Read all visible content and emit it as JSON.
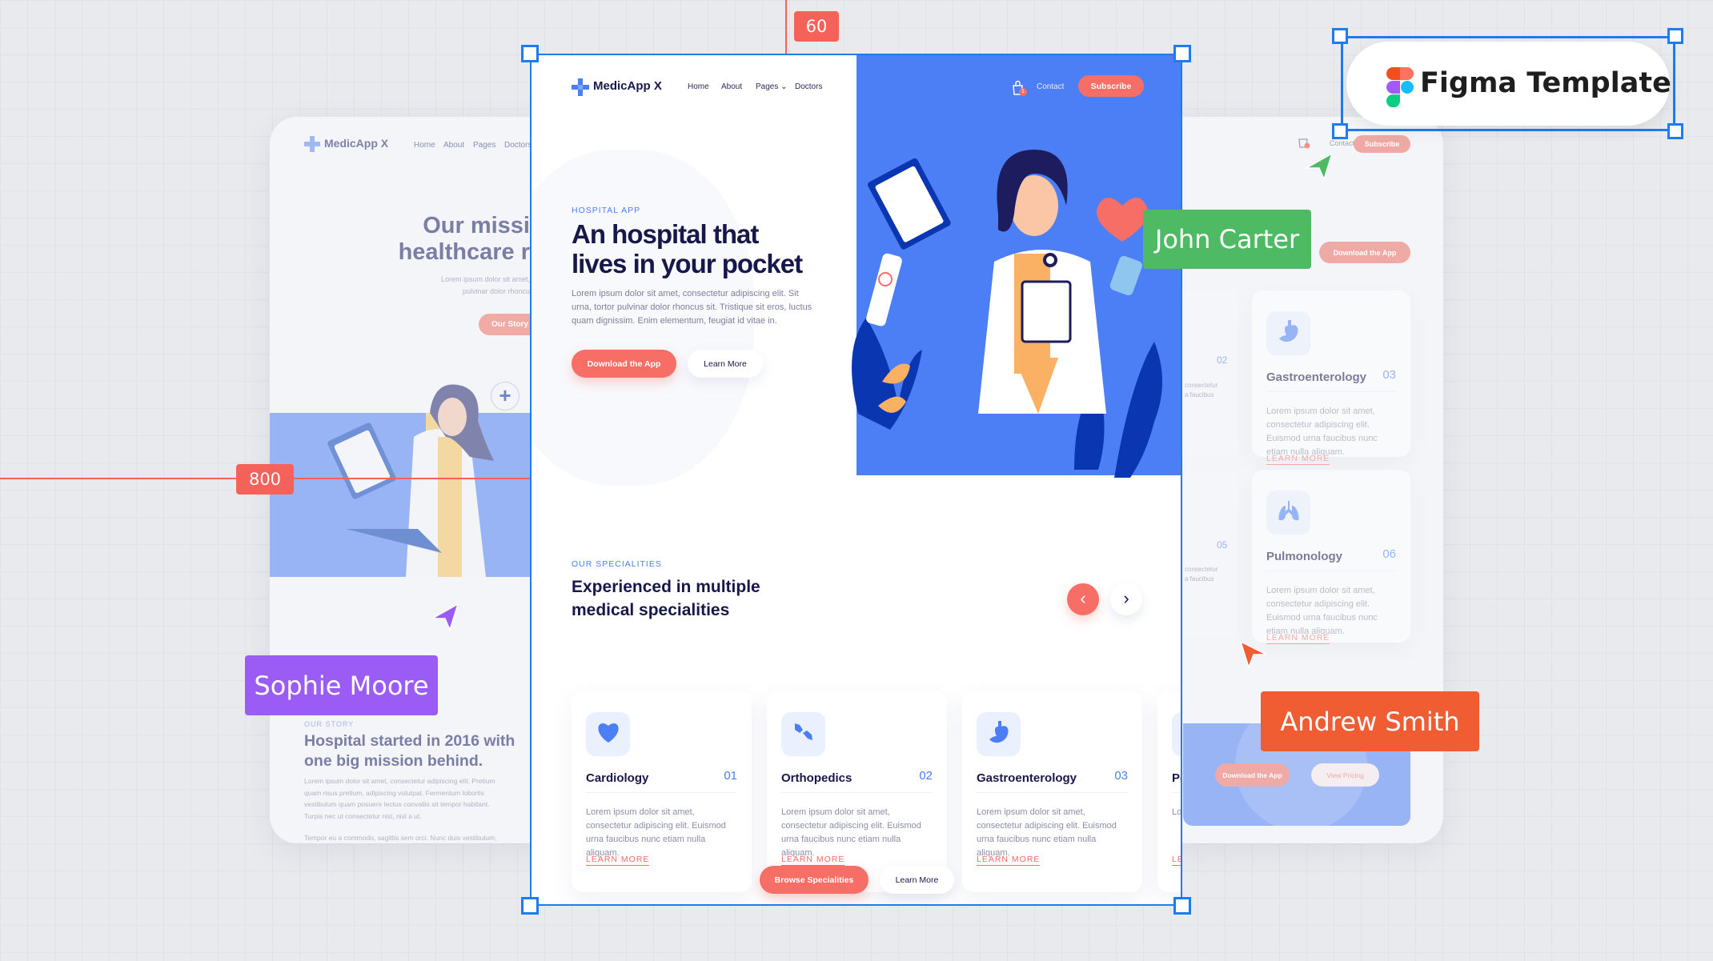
{
  "colors": {
    "accent_blue": "#4c7ff5",
    "coral": "#f66e65",
    "navy": "#17184a",
    "green": "#4fba64",
    "purple": "#9b5cf6",
    "orange": "#f05d33",
    "selection": "#1f7cf0"
  },
  "nav": {
    "brand": "MedicApp X",
    "links": [
      "Home",
      "About",
      "Pages",
      "Doctors"
    ],
    "contact": "Contact",
    "subscribe": "Subscribe",
    "cart_count": "1"
  },
  "hero": {
    "eyebrow": "HOSPITAL APP",
    "title_line1": "An hospital that",
    "title_line2": "lives in your pocket",
    "body": "Lorem ipsum dolor sit amet, consectetur adipiscing elit. Sit urna, tortor pulvinar dolor rhoncus sit. Tristique sit eros, luctus quam dignissim. Enim elementum, feugiat id vitae in.",
    "primary": "Download the App",
    "secondary": "Learn More"
  },
  "specialities": {
    "eyebrow": "OUR SPECIALITIES",
    "title_line1": "Experienced in multiple",
    "title_line2": "medical specialities",
    "cards": [
      {
        "icon": "heart-icon",
        "title": "Cardiology",
        "number": "01",
        "body": "Lorem ipsum dolor sit amet, consectetur adipiscing elit. Euismod urna faucibus nunc etiam nulla aliquam.",
        "link": "LEARN MORE"
      },
      {
        "icon": "bones-icon",
        "title": "Orthopedics",
        "number": "02",
        "body": "Lorem ipsum dolor sit amet, consectetur adipiscing elit. Euismod urna faucibus nunc etiam nulla aliquam.",
        "link": "LEARN MORE"
      },
      {
        "icon": "stomach-icon",
        "title": "Gastroenterology",
        "number": "03",
        "body": "Lorem ipsum dolor sit amet, consectetur adipiscing elit. Euismod urna faucibus nunc etiam nulla aliquam.",
        "link": "LEARN MORE"
      },
      {
        "icon": "lungs-icon",
        "title": "Pe",
        "number": "",
        "body": "Lo ad nu",
        "link": "LE"
      }
    ],
    "browse": "Browse Specialities",
    "learn": "Learn More"
  },
  "left_page": {
    "brand": "MedicApp X",
    "links": [
      "Home",
      "About",
      "Pages",
      "Doctors"
    ],
    "title_line1": "Our missi",
    "title_line2": "healthcare r",
    "body_line1": "Lorem ipsum dolor sit amet,",
    "body_line2": "pulvinar dolor rhoncu",
    "button": "Our Story",
    "story_eyebrow": "OUR STORY",
    "story_title_line1": "Hospital started in 2016 with",
    "story_title_line2": "one big mission behind.",
    "story_body": "Lorem ipsum dolor sit amet, consectetur adipiscing elit. Pretium quam risus pretium, adipiscing volutpat. Fermentum lobortis vestibulum quam posuere lectus convallis sit tempor habitant. Turpis nec ut consectetur nisi, nisl a ut.",
    "story_body2": "Tempor eu a commodo, sagittis sem orci. Nunc duis vestibulum,"
  },
  "right_page": {
    "contact": "Contact",
    "subscribe": "Subscribe",
    "download": "Download the App",
    "partial_text1": "consectetur",
    "partial_text2": "a faucibus",
    "partial_num1": "02",
    "partial_num2": "05",
    "cards": [
      {
        "title": "Gastroenterology",
        "number": "03",
        "body": "Lorem ipsum dolor sit amet, consectetur adipiscing elit. Euismod urna faucibus nunc etiam nulla aliquam.",
        "link": "LEARN MORE"
      },
      {
        "title": "Pulmonology",
        "number": "06",
        "body": "Lorem ipsum dolor sit amet, consectetur adipiscing elit. Euismod urna faucibus nunc etiam nulla aliquam.",
        "link": "LEARN MORE"
      }
    ],
    "cta_download": "Download the App",
    "cta_pricing": "View Pricing"
  },
  "overlay": {
    "ruler_x": "60",
    "ruler_y": "800",
    "figma_label": "Figma Template",
    "cursors": [
      {
        "name": "John Carter",
        "color": "#4fba64"
      },
      {
        "name": "Sophie Moore",
        "color": "#9b5cf6"
      },
      {
        "name": "Andrew Smith",
        "color": "#f05d33"
      }
    ]
  }
}
